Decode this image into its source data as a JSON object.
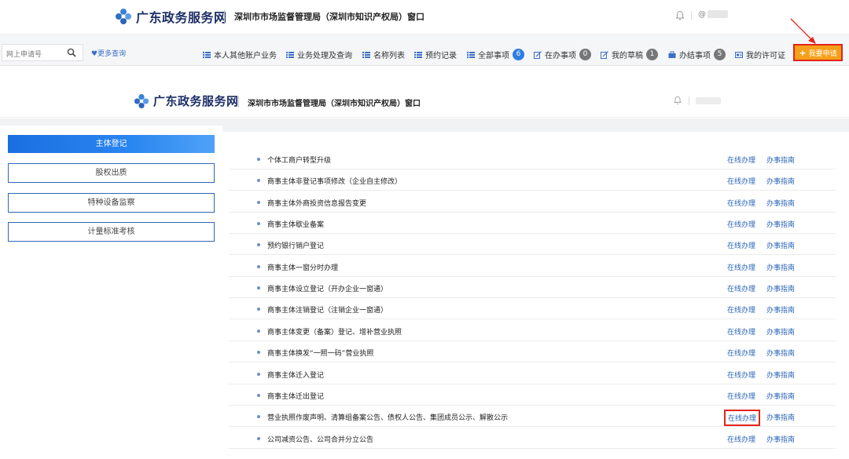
{
  "header": {
    "logo_text": "广东政务服务网",
    "window_name": "深圳市市场监督管理局（深圳市知识产权局）窗口",
    "user_prefix": "@"
  },
  "navbar": {
    "search_placeholder": "网上申请号",
    "more_query": "更多查询",
    "items": [
      {
        "label": "本人其他账户业务",
        "icon": "list-icon"
      },
      {
        "label": "业务处理及查询",
        "icon": "list-icon"
      },
      {
        "label": "名称列表",
        "icon": "list-icon"
      },
      {
        "label": "预约记录",
        "icon": "list-icon"
      },
      {
        "label": "全部事项",
        "icon": "list-icon",
        "badge": "6"
      },
      {
        "label": "在办事项",
        "icon": "edit-icon",
        "badge": "0"
      },
      {
        "label": "我的草稿",
        "icon": "edit-icon",
        "badge": "1"
      },
      {
        "label": "办结事项",
        "icon": "briefcase-icon",
        "badge": "5"
      },
      {
        "label": "我的许可证",
        "icon": "card-icon"
      }
    ],
    "apply_button": "我要申请"
  },
  "header2": {
    "logo_text": "广东政务服务网",
    "window_name": "深圳市市场监督管理局（深圳市知识产权局）窗口"
  },
  "sidebar": {
    "active": "主体登记",
    "items": [
      "股权出质",
      "特种设备监察",
      "计量标准考核"
    ]
  },
  "services": {
    "online_label": "在线办理",
    "guide_label": "办事指南",
    "items": [
      "个体工商户转型升级",
      "商事主体非登记事项修改（企业自主修改）",
      "商事主体外商投资信息报告变更",
      "商事主体歇业备案",
      "预约银行销户登记",
      "商事主体一窗分时办理",
      "商事主体设立登记（开办企业一窗通）",
      "商事主体注销登记（注销企业一窗通）",
      "商事主体变更（备案）登记、增补营业执照",
      "商事主体换发“一照一码”营业执照",
      "商事主体迁入登记",
      "商事主体迁出登记",
      "营业执照作废声明、清算组备案公告、债权人公告、集团成员公示、解散公示",
      "公司减资公告、公司合并分立公告"
    ],
    "highlighted_index": 12
  },
  "colors": {
    "accent_blue": "#2a64b8",
    "apply_orange": "#f5a01a",
    "highlight_red": "#e2231a"
  }
}
